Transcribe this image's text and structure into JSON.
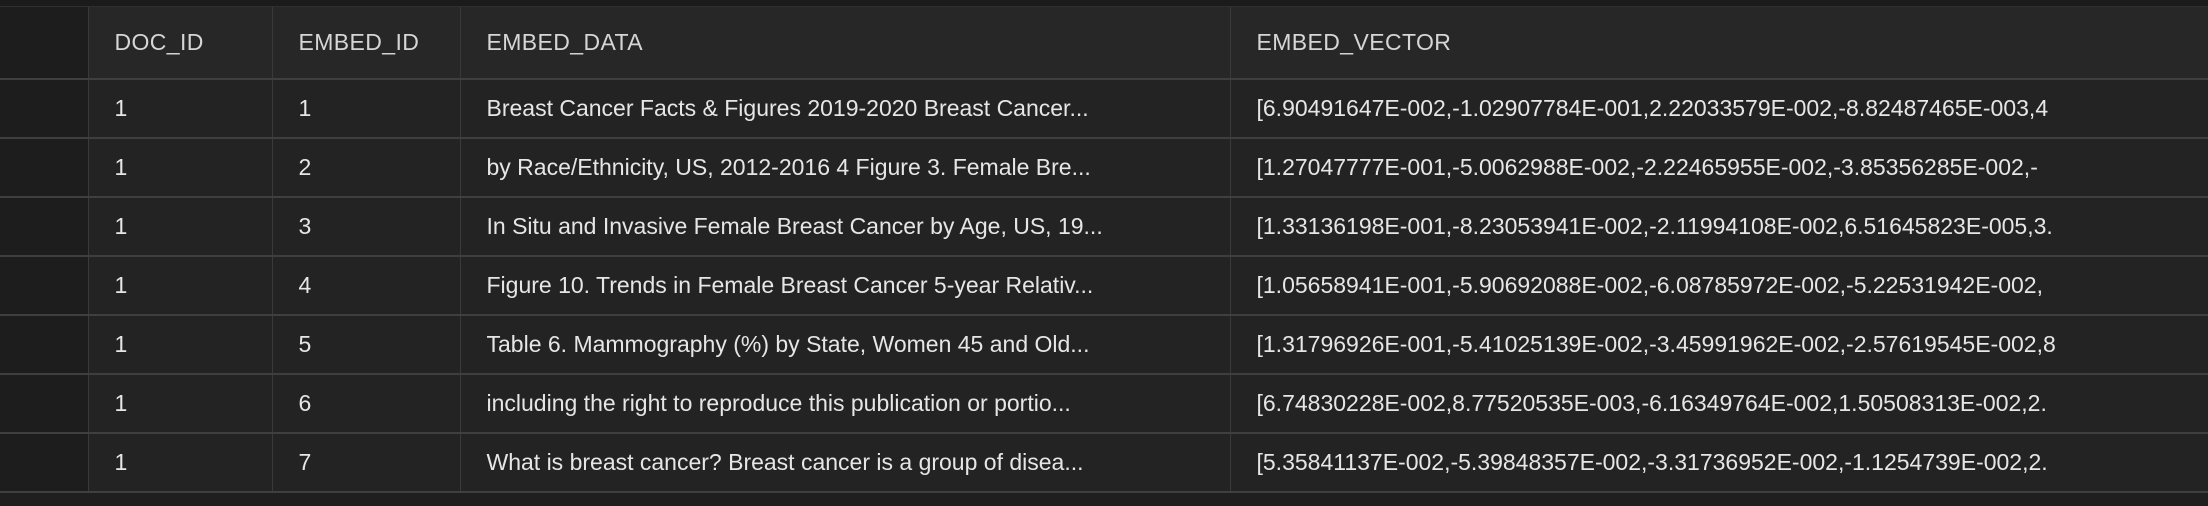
{
  "columns": [
    "DOC_ID",
    "EMBED_ID",
    "EMBED_DATA",
    "EMBED_VECTOR"
  ],
  "rows": [
    {
      "doc_id": "1",
      "embed_id": "1",
      "embed_data": "Breast Cancer Facts & Figures 2019-2020 Breast Cancer...",
      "embed_vector": "[6.90491647E-002,-1.02907784E-001,2.22033579E-002,-8.82487465E-003,4"
    },
    {
      "doc_id": "1",
      "embed_id": "2",
      "embed_data": "by Race/Ethnicity, US, 2012-2016 4 Figure 3. Female Bre...",
      "embed_vector": "[1.27047777E-001,-5.0062988E-002,-2.22465955E-002,-3.85356285E-002,-"
    },
    {
      "doc_id": "1",
      "embed_id": "3",
      "embed_data": "In Situ and Invasive Female Breast Cancer by Age, US, 19...",
      "embed_vector": "[1.33136198E-001,-8.23053941E-002,-2.11994108E-002,6.51645823E-005,3."
    },
    {
      "doc_id": "1",
      "embed_id": "4",
      "embed_data": "Figure 10. Trends in Female Breast Cancer 5-year Relativ...",
      "embed_vector": "[1.05658941E-001,-5.90692088E-002,-6.08785972E-002,-5.22531942E-002,"
    },
    {
      "doc_id": "1",
      "embed_id": "5",
      "embed_data": "Table 6. Mammography (%) by State, Women 45 and Old...",
      "embed_vector": "[1.31796926E-001,-5.41025139E-002,-3.45991962E-002,-2.57619545E-002,8"
    },
    {
      "doc_id": "1",
      "embed_id": "6",
      "embed_data": "including the right to reproduce this publication or portio...",
      "embed_vector": "[6.74830228E-002,8.77520535E-003,-6.16349764E-002,1.50508313E-002,2."
    },
    {
      "doc_id": "1",
      "embed_id": "7",
      "embed_data": "What is breast cancer? Breast cancer is a group of disea...",
      "embed_vector": "[5.35841137E-002,-5.39848357E-002,-3.31736952E-002,-1.1254739E-002,2."
    }
  ]
}
